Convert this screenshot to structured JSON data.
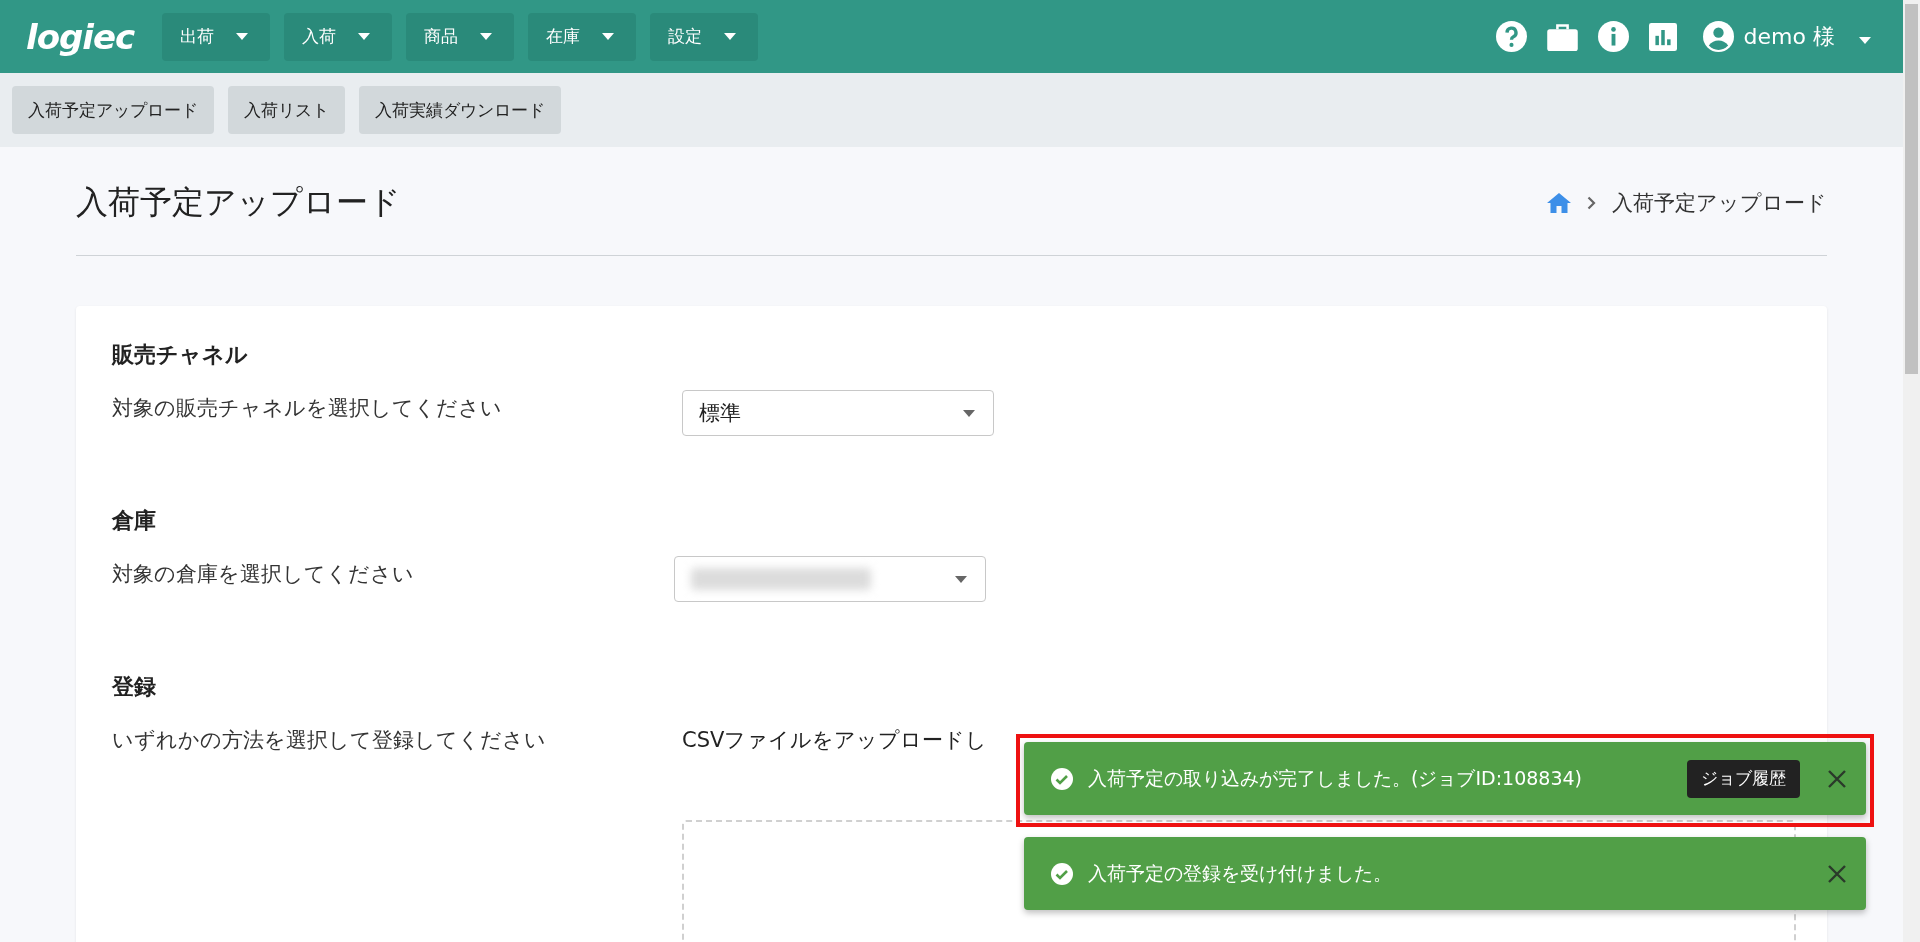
{
  "header": {
    "logo": "logiec",
    "menus": [
      {
        "label": "出荷"
      },
      {
        "label": "入荷"
      },
      {
        "label": "商品"
      },
      {
        "label": "在庫"
      },
      {
        "label": "設定"
      }
    ],
    "user": "demo 様"
  },
  "subnav": [
    {
      "label": "入荷予定アップロード"
    },
    {
      "label": "入荷リスト"
    },
    {
      "label": "入荷実績ダウンロード"
    }
  ],
  "page": {
    "title": "入荷予定アップロード",
    "breadcrumb": "入荷予定アップロード"
  },
  "sections": [
    {
      "kind": "select",
      "heading": "販売チャネル",
      "label": "対象の販売チャネルを選択してください",
      "value": "標準"
    },
    {
      "kind": "redacted-select",
      "heading": "倉庫",
      "label": "対象の倉庫を選択してください"
    },
    {
      "kind": "upload",
      "heading": "登録",
      "label": "いずれかの方法を選択して登録してください",
      "text": "CSVファイルをアップロードし"
    }
  ],
  "toasts": [
    {
      "message": "入荷予定の取り込みが完了しました。(ジョブID:108834)",
      "action": "ジョブ履歴",
      "highlighted": true
    },
    {
      "message": "入荷予定の登録を受け付けました。",
      "highlighted": false
    }
  ]
}
